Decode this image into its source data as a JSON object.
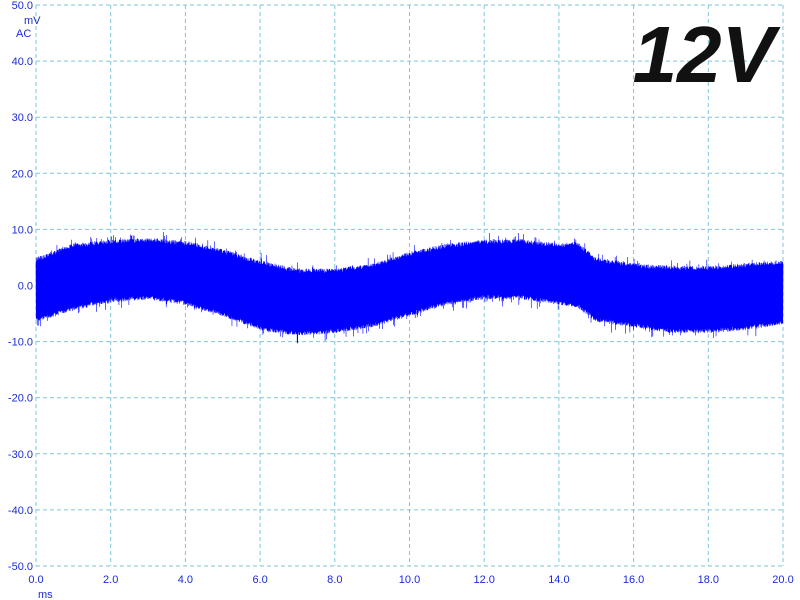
{
  "chart_data": {
    "type": "line",
    "annotation": "12V",
    "y_unit": "mV",
    "y_coupling": "AC",
    "x_unit": "ms",
    "xlim": [
      0,
      20
    ],
    "ylim": [
      -50,
      50
    ],
    "x_ticks": [
      "0.0",
      "2.0",
      "4.0",
      "6.0",
      "8.0",
      "10.0",
      "12.0",
      "14.0",
      "16.0",
      "18.0",
      "20.0"
    ],
    "y_ticks": [
      "50.0",
      "40.0",
      "30.0",
      "20.0",
      "10.0",
      "0.0",
      "-10.0",
      "-20.0",
      "-30.0",
      "-40.0",
      "-50.0"
    ],
    "grid": true,
    "series": [
      {
        "color": "#0000ff",
        "envelope": {
          "x": [
            0.0,
            1.0,
            2.0,
            3.0,
            4.0,
            5.0,
            6.0,
            7.0,
            8.0,
            9.0,
            10.0,
            11.0,
            12.0,
            13.0,
            14.0,
            14.5,
            15.0,
            16.0,
            17.0,
            18.0,
            19.0,
            20.0
          ],
          "max": [
            5.0,
            7.5,
            8.2,
            8.5,
            8.0,
            6.5,
            4.5,
            3.0,
            3.0,
            4.0,
            6.0,
            7.5,
            8.2,
            8.3,
            7.5,
            7.8,
            5.0,
            4.0,
            3.5,
            3.5,
            4.0,
            4.5
          ],
          "min": [
            -6.5,
            -4.5,
            -3.0,
            -2.5,
            -3.5,
            -5.5,
            -8.0,
            -9.0,
            -8.5,
            -7.5,
            -5.5,
            -3.5,
            -2.5,
            -2.5,
            -3.5,
            -4.0,
            -6.5,
            -7.5,
            -8.5,
            -8.5,
            -8.0,
            -7.0
          ]
        }
      }
    ]
  },
  "colors": {
    "trace": "#0000ff",
    "grid": "#7fc6d6",
    "ticks": "#1a2bd8"
  }
}
